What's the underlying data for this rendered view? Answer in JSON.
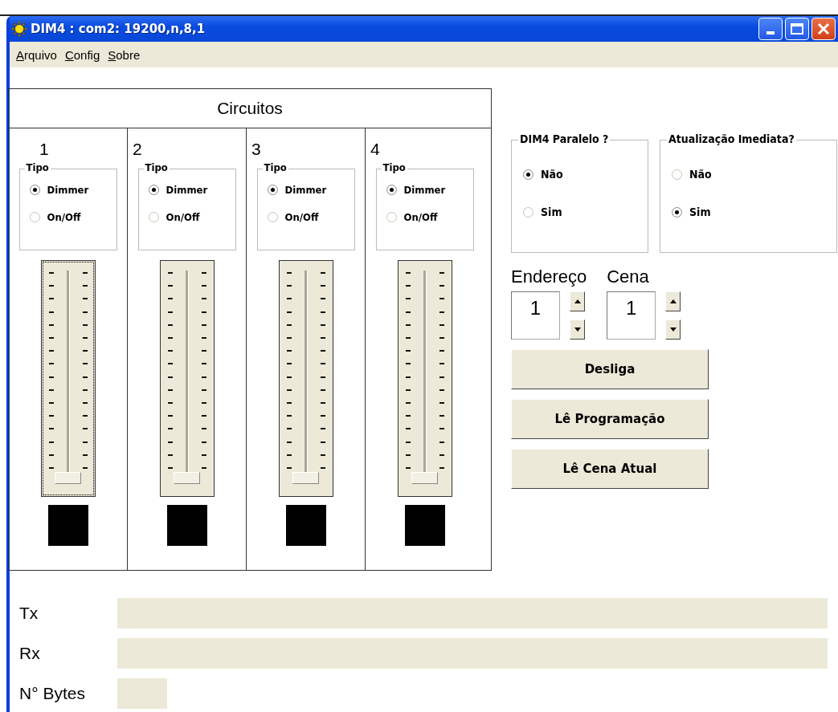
{
  "window": {
    "title": "DIM4 : com2: 19200,n,8,1"
  },
  "menu": [
    "Arquivo",
    "Config",
    "Sobre"
  ],
  "circuits": {
    "title": "Circuitos",
    "channels": [
      {
        "number": "1",
        "group_label": "Tipo",
        "options": [
          {
            "label": "Dimmer",
            "selected": true
          },
          {
            "label": "On/Off",
            "selected": false
          }
        ],
        "level": 0,
        "focused": true
      },
      {
        "number": "2",
        "group_label": "Tipo",
        "options": [
          {
            "label": "Dimmer",
            "selected": true
          },
          {
            "label": "On/Off",
            "selected": false
          }
        ],
        "level": 0,
        "focused": false
      },
      {
        "number": "3",
        "group_label": "Tipo",
        "options": [
          {
            "label": "Dimmer",
            "selected": true
          },
          {
            "label": "On/Off",
            "selected": false
          }
        ],
        "level": 0,
        "focused": false
      },
      {
        "number": "4",
        "group_label": "Tipo",
        "options": [
          {
            "label": "Dimmer",
            "selected": true
          },
          {
            "label": "On/Off",
            "selected": false
          }
        ],
        "level": 0,
        "focused": false
      }
    ]
  },
  "option_groups": [
    {
      "title": "DIM4 Paralelo ?",
      "options": [
        {
          "label": "Não",
          "selected": true
        },
        {
          "label": "Sim",
          "selected": false
        }
      ]
    },
    {
      "title": "Atualização Imediata?",
      "options": [
        {
          "label": "Não",
          "selected": false
        },
        {
          "label": "Sim",
          "selected": true
        }
      ]
    }
  ],
  "spinners": [
    {
      "label": "Endereço",
      "value": "1"
    },
    {
      "label": "Cena",
      "value": "1"
    }
  ],
  "buttons": [
    "Desliga",
    "Lê Programação",
    "Lê Cena Atual"
  ],
  "status_fields": [
    {
      "label": "Tx",
      "kind": "wide"
    },
    {
      "label": "Rx",
      "kind": "wide"
    },
    {
      "label": "N° Bytes",
      "kind": "narrow"
    }
  ]
}
